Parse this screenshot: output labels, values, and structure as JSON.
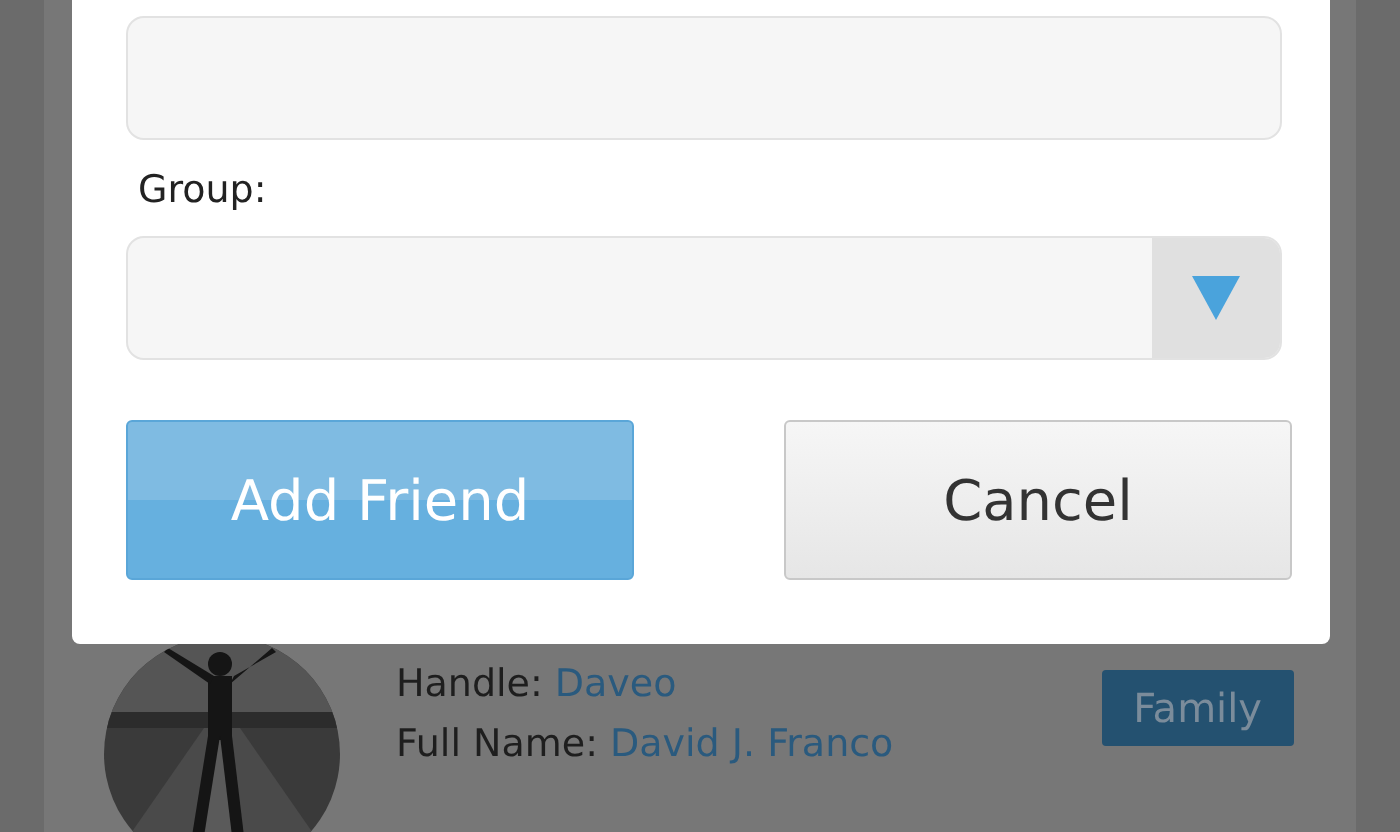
{
  "dialog": {
    "fields": [
      {
        "kind": "text"
      },
      {
        "kind": "select",
        "label": "Group:"
      }
    ],
    "buttons": [
      {
        "label": "Add Friend",
        "kind": "primary"
      },
      {
        "label": "Cancel",
        "kind": "secondary"
      }
    ]
  },
  "friend": {
    "handle_label": "Handle:",
    "handle": "Daveo",
    "name_label": "Full Name:",
    "full_name": "David J. Franco",
    "group": "Family"
  }
}
